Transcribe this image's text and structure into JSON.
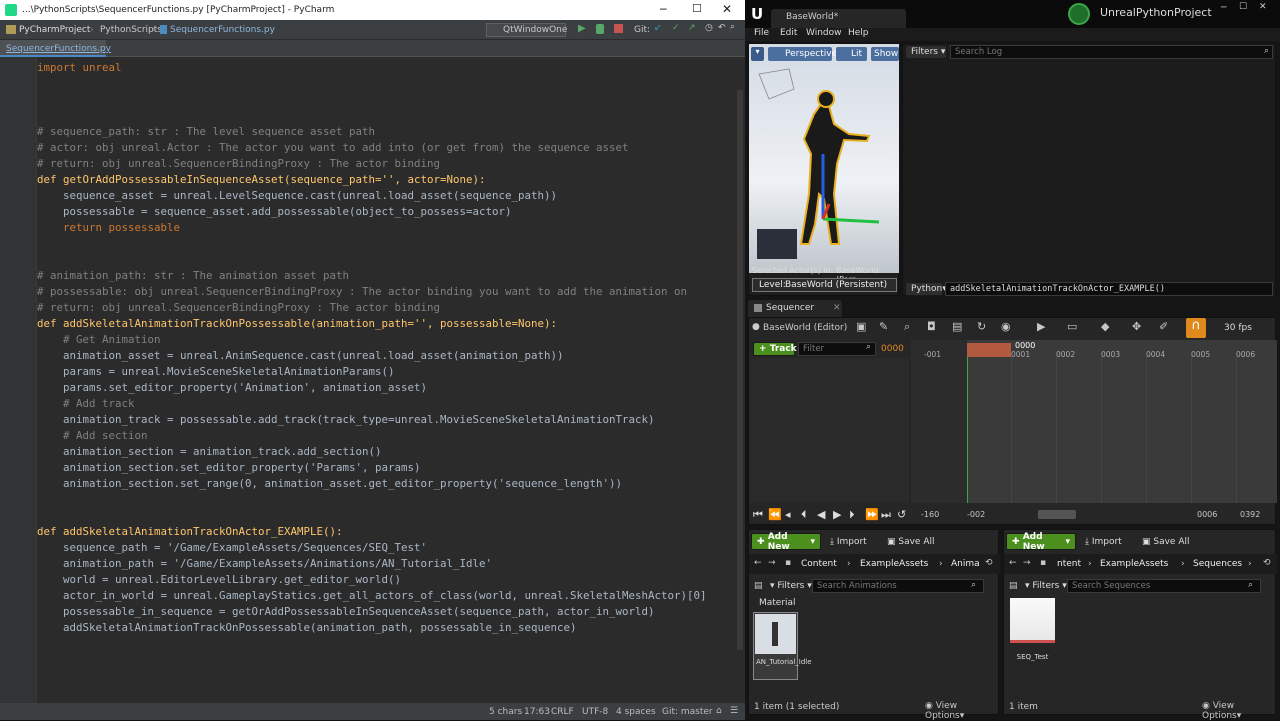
{
  "pycharm": {
    "window_title": "...\\PythonScripts\\SequencerFunctions.py [PyCharmProject] - PyCharm",
    "breadcrumb": [
      "PyCharmProject",
      "PythonScripts",
      "SequencerFunctions.py"
    ],
    "run_config": "QtWindowOne",
    "git_label": "Git:",
    "tab_name": "SequencerFunctions.py",
    "status": {
      "chars": "5 chars",
      "position": "17:63",
      "line_sep": "CRLF",
      "encoding": "UTF-8",
      "indent": "4 spaces",
      "git": "Git: master"
    }
  },
  "code": [
    "import unreal",
    "",
    "",
    "",
    "# sequence_path: str : The level sequence asset path",
    "# actor: obj unreal.Actor : The actor you want to add into (or get from) the sequence asset",
    "# return: obj unreal.SequencerBindingProxy : The actor binding",
    "def getOrAddPossessableInSequenceAsset(sequence_path='', actor=None):",
    "    sequence_asset = unreal.LevelSequence.cast(unreal.load_asset(sequence_path))",
    "    possessable = sequence_asset.add_possessable(object_to_possess=actor)",
    "    return possessable",
    "",
    "",
    "# animation_path: str : The animation asset path",
    "# possessable: obj unreal.SequencerBindingProxy : The actor binding you want to add the animation on",
    "# return: obj unreal.SequencerBindingProxy : The actor binding",
    "def addSkeletalAnimationTrackOnPossessable(animation_path='', possessable=None):",
    "    # Get Animation",
    "    animation_asset = unreal.AnimSequence.cast(unreal.load_asset(animation_path))",
    "    params = unreal.MovieSceneSkeletalAnimationParams()",
    "    params.set_editor_property('Animation', animation_asset)",
    "    # Add track",
    "    animation_track = possessable.add_track(track_type=unreal.MovieSceneSkeletalAnimationTrack)",
    "    # Add section",
    "    animation_section = animation_track.add_section()",
    "    animation_section.set_editor_property('Params', params)",
    "    animation_section.set_range(0, animation_asset.get_editor_property('sequence_length'))",
    "",
    "",
    "def addSkeletalAnimationTrackOnActor_EXAMPLE():",
    "    sequence_path = '/Game/ExampleAssets/Sequences/SEQ_Test'",
    "    animation_path = '/Game/ExampleAssets/Animations/AN_Tutorial_Idle'",
    "    world = unreal.EditorLevelLibrary.get_editor_world()",
    "    actor_in_world = unreal.GameplayStatics.get_all_actors_of_class(world, unreal.SkeletalMeshActor)[0]",
    "    possessable_in_sequence = getOrAddPossessableInSequenceAsset(sequence_path, actor_in_world)",
    "    addSkeletalAnimationTrackOnPossessable(animation_path, possessable_in_sequence)"
  ],
  "unreal": {
    "tab": "BaseWorld*",
    "project": "UnrealPythonProject",
    "menu": [
      "File",
      "Edit",
      "Window",
      "Help"
    ],
    "viewport": {
      "perspective": "Perspective",
      "lit": "Lit",
      "show": "Show",
      "selected": "Selected Actor(s) in:",
      "selected_world": "BaseWorld (Pers",
      "level": "Level:",
      "level_name": "BaseWorld (Persistent)"
    },
    "log": {
      "filters": "Filters",
      "search_placeholder": "Search Log",
      "python_label": "Python",
      "command": "addSkeletalAnimationTrackOnActor_EXAMPLE()"
    },
    "sequencer": {
      "tab": "Sequencer",
      "world": "BaseWorld (Editor)",
      "fps": "30 fps",
      "track_btn": "Track",
      "filter_placeholder": "Filter",
      "frame": "0000",
      "playhead": "0000",
      "ticks": [
        "-001",
        "0001",
        "0002",
        "0003",
        "0004",
        "0005",
        "0006"
      ],
      "range": [
        "-160",
        "-002",
        "0006",
        "0392"
      ]
    },
    "content_left": {
      "add_new": "Add New",
      "import": "Import",
      "save_all": "Save All",
      "path": [
        "Content",
        "ExampleAssets",
        "Anima"
      ],
      "filters": "Filters",
      "search_placeholder": "Search Animations",
      "category": "Material",
      "asset_name": "AN_Tutorial_Idle",
      "count": "1 item (1 selected)",
      "view_options": "View Options"
    },
    "content_right": {
      "add_new": "Add New",
      "import": "Import",
      "save_all": "Save All",
      "path": [
        "ntent",
        "ExampleAssets",
        "Sequences"
      ],
      "filters": "Filters",
      "search_placeholder": "Search Sequences",
      "asset_name": "SEQ_Test",
      "count": "1 item",
      "view_options": "View Options"
    }
  }
}
